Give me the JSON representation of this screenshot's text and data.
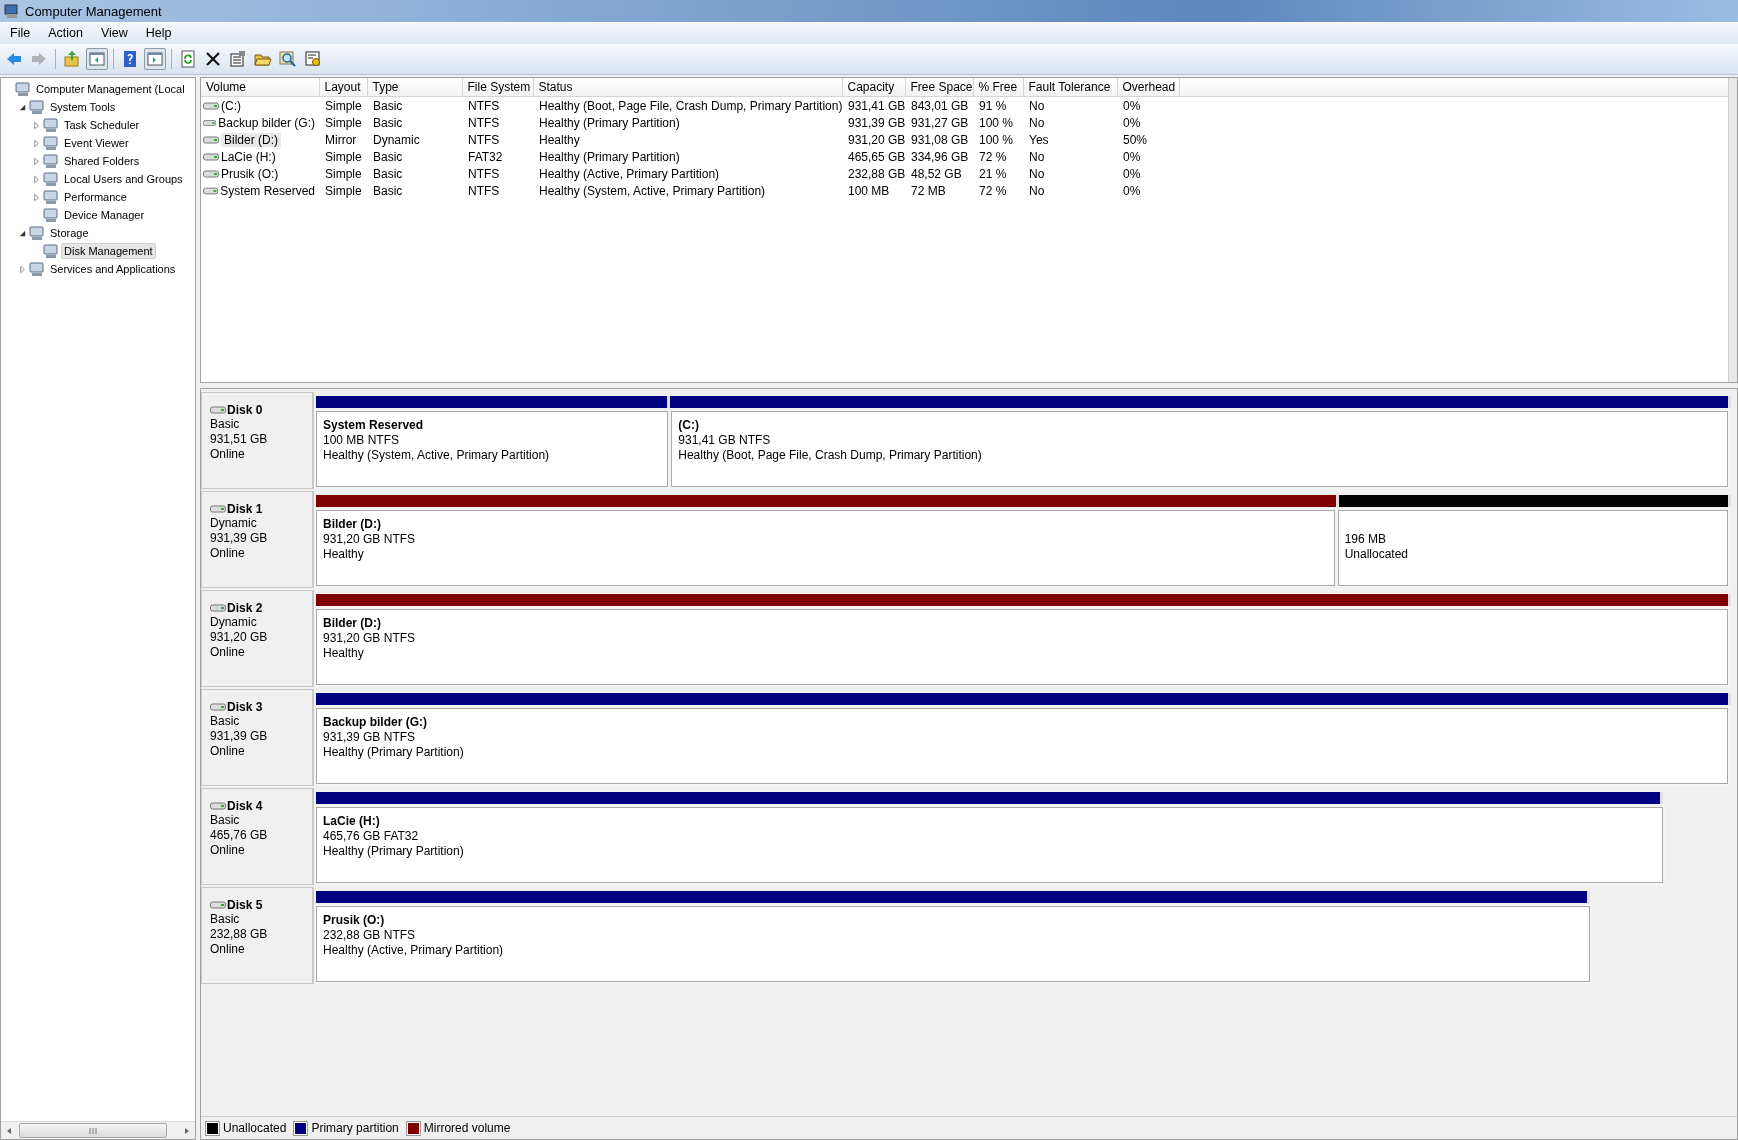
{
  "window": {
    "title": "Computer Management"
  },
  "menu": [
    "File",
    "Action",
    "View",
    "Help"
  ],
  "toolbar": [
    {
      "kind": "back",
      "disabled": false,
      "pressed": false
    },
    {
      "kind": "forward",
      "disabled": true,
      "pressed": false
    },
    {
      "kind": "separator"
    },
    {
      "kind": "up",
      "disabled": false,
      "pressed": false
    },
    {
      "kind": "tree",
      "disabled": false,
      "pressed": true
    },
    {
      "kind": "separator"
    },
    {
      "kind": "help",
      "disabled": false,
      "pressed": false
    },
    {
      "kind": "pane",
      "disabled": false,
      "pressed": true
    },
    {
      "kind": "separator"
    },
    {
      "kind": "refresh",
      "disabled": false,
      "pressed": false
    },
    {
      "kind": "delete",
      "disabled": false,
      "pressed": false
    },
    {
      "kind": "properties",
      "disabled": false,
      "pressed": false
    },
    {
      "kind": "open",
      "disabled": false,
      "pressed": false
    },
    {
      "kind": "search",
      "disabled": false,
      "pressed": false
    },
    {
      "kind": "settings",
      "disabled": false,
      "pressed": false
    }
  ],
  "tree": [
    {
      "label": "Computer Management (Local",
      "selected": false,
      "children": [
        {
          "label": "System Tools",
          "selected": false,
          "expanded": true,
          "children": [
            {
              "label": "Task Scheduler",
              "selected": false,
              "expanded": false
            },
            {
              "label": "Event Viewer",
              "selected": false,
              "expanded": false
            },
            {
              "label": "Shared Folders",
              "selected": false,
              "expanded": false
            },
            {
              "label": "Local Users and Groups",
              "selected": false,
              "expanded": false
            },
            {
              "label": "Performance",
              "selected": false,
              "expanded": false
            },
            {
              "label": "Device Manager",
              "selected": false
            }
          ]
        },
        {
          "label": "Storage",
          "selected": false,
          "expanded": true,
          "children": [
            {
              "label": "Disk Management",
              "selected": true
            }
          ]
        },
        {
          "label": "Services and Applications",
          "selected": false,
          "expanded": false
        }
      ]
    }
  ],
  "table": {
    "columns": [
      "Volume",
      "Layout",
      "Type",
      "File System",
      "Status",
      "Capacity",
      "Free Space",
      "% Free",
      "Fault Tolerance",
      "Overhead"
    ],
    "rows": [
      {
        "selected": false,
        "cells": [
          "(C:)",
          "Simple",
          "Basic",
          "NTFS",
          "Healthy (Boot, Page File, Crash Dump, Primary Partition)",
          "931,41 GB",
          "843,01 GB",
          "91 %",
          "No",
          "0%"
        ]
      },
      {
        "selected": false,
        "cells": [
          "Backup bilder (G:)",
          "Simple",
          "Basic",
          "NTFS",
          "Healthy (Primary Partition)",
          "931,39 GB",
          "931,27 GB",
          "100 %",
          "No",
          "0%"
        ]
      },
      {
        "selected": true,
        "cells": [
          "Bilder (D:)",
          "Mirror",
          "Dynamic",
          "NTFS",
          "Healthy",
          "931,20 GB",
          "931,08 GB",
          "100 %",
          "Yes",
          "50%"
        ]
      },
      {
        "selected": false,
        "cells": [
          "LaCie (H:)",
          "Simple",
          "Basic",
          "FAT32",
          "Healthy (Primary Partition)",
          "465,65 GB",
          "334,96 GB",
          "72 %",
          "No",
          "0%"
        ]
      },
      {
        "selected": false,
        "cells": [
          "Prusik (O:)",
          "Simple",
          "Basic",
          "NTFS",
          "Healthy (Active, Primary Partition)",
          "232,88 GB",
          "48,52 GB",
          "21 %",
          "No",
          "0%"
        ]
      },
      {
        "selected": false,
        "cells": [
          "System Reserved",
          "Simple",
          "Basic",
          "NTFS",
          "Healthy (System, Active, Primary Partition)",
          "100 MB",
          "72 MB",
          "72 %",
          "No",
          "0%"
        ]
      }
    ]
  },
  "disks": [
    {
      "name": "Disk 0",
      "type": "Basic",
      "size": "931,51 GB",
      "status": "Online",
      "partitions": [
        {
          "kind": "primary",
          "name": "System Reserved",
          "detail": "100 MB NTFS",
          "status": "Healthy (System, Active, Primary Partition)"
        },
        {
          "kind": "primary",
          "name": "(C:)",
          "detail": "931,41 GB NTFS",
          "status": "Healthy (Boot, Page File, Crash Dump, Primary Partition)"
        }
      ]
    },
    {
      "name": "Disk 1",
      "type": "Dynamic",
      "size": "931,39 GB",
      "status": "Online",
      "partitions": [
        {
          "kind": "mirrored",
          "name": "Bilder  (D:)",
          "detail": "931,20 GB NTFS",
          "status": "Healthy"
        },
        {
          "kind": "unallocated",
          "detail": "196 MB",
          "status": "Unallocated"
        }
      ]
    },
    {
      "name": "Disk 2",
      "type": "Dynamic",
      "size": "931,20 GB",
      "status": "Online",
      "partitions": [
        {
          "kind": "mirrored",
          "name": "Bilder  (D:)",
          "detail": "931,20 GB NTFS",
          "status": "Healthy"
        }
      ]
    },
    {
      "name": "Disk 3",
      "type": "Basic",
      "size": "931,39 GB",
      "status": "Online",
      "partitions": [
        {
          "kind": "primary",
          "name": "Backup bilder  (G:)",
          "detail": "931,39 GB NTFS",
          "status": "Healthy (Primary Partition)"
        }
      ]
    },
    {
      "name": "Disk 4",
      "type": "Basic",
      "size": "465,76 GB",
      "status": "Online",
      "partitions": [
        {
          "kind": "primary",
          "name": "LaCie  (H:)",
          "detail": "465,76 GB FAT32",
          "status": "Healthy (Primary Partition)"
        }
      ]
    },
    {
      "name": "Disk 5",
      "type": "Basic",
      "size": "232,88 GB",
      "status": "Online",
      "partitions": [
        {
          "kind": "primary",
          "name": "Prusik  (O:)",
          "detail": "232,88 GB NTFS",
          "status": "Healthy (Active, Primary Partition)"
        }
      ]
    }
  ],
  "legend": [
    {
      "label": "Unallocated",
      "color": "#000000"
    },
    {
      "label": "Primary partition",
      "color": "#000080"
    },
    {
      "label": "Mirrored volume",
      "color": "#800000"
    }
  ]
}
